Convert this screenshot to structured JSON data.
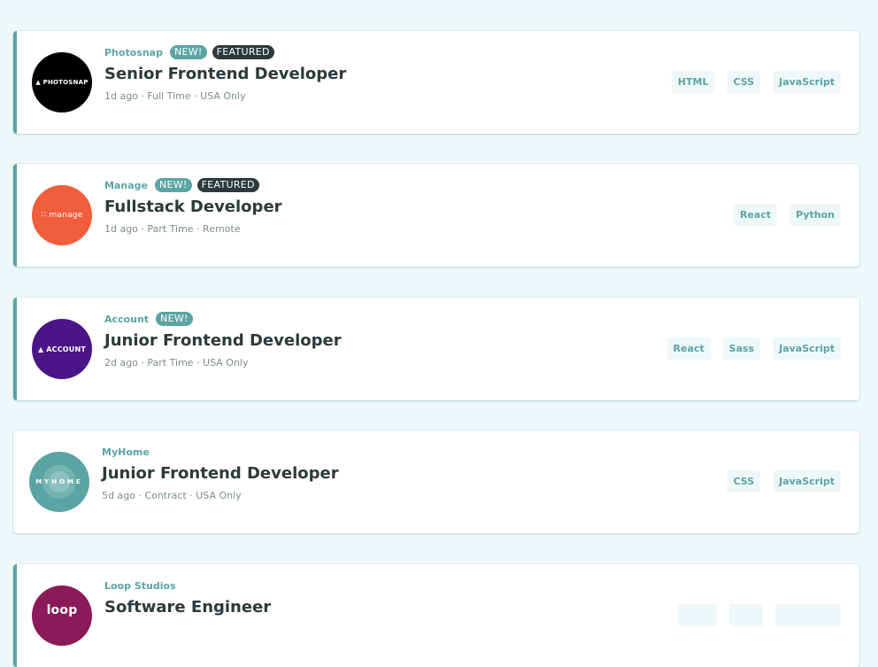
{
  "jobs": [
    {
      "logo_text": "▲ PHOTOSNAP",
      "logo_color": "#000000",
      "company": "Photosnap",
      "new": "NEW!",
      "featured": "FEATURED",
      "position": "Senior Frontend Developer",
      "meta": "1d ago · Full Time · USA Only",
      "tags": [
        "HTML",
        "CSS",
        "JavaScript"
      ]
    },
    {
      "logo_text": "∷ manage",
      "logo_color": "#f15e3b",
      "company": "Manage",
      "new": "NEW!",
      "featured": "FEATURED",
      "position": "Fullstack Developer",
      "meta": "1d ago · Part Time · Remote",
      "tags": [
        "React",
        "Python"
      ]
    },
    {
      "logo_text": "▲ ACCOUNT",
      "logo_color": "#4a1584",
      "company": "Account",
      "new": "NEW!",
      "featured": "",
      "position": "Junior Frontend Developer",
      "meta": "2d ago · Part Time · USA Only",
      "tags": [
        "React",
        "Sass",
        "JavaScript"
      ]
    },
    {
      "logo_text": "MYHOME",
      "logo_color": "#5ba4a4",
      "company": "MyHome",
      "new": "",
      "featured": "",
      "position": "Junior Frontend Developer",
      "meta": "5d ago · Contract · USA Only",
      "tags": [
        "CSS",
        "JavaScript"
      ]
    },
    {
      "logo_text": "loop",
      "logo_color": "#8b1a59",
      "company": "Loop Studios",
      "new": "",
      "featured": "",
      "position": "Software Engineer",
      "meta": "",
      "tags": [
        "",
        "",
        ""
      ]
    }
  ]
}
